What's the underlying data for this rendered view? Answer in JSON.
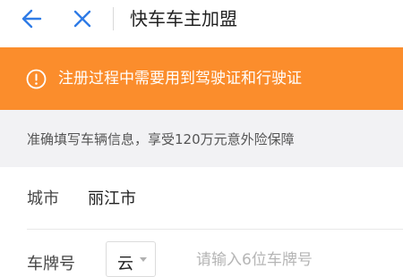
{
  "header": {
    "title": "快车车主加盟",
    "back_icon": "arrow-left-icon",
    "close_icon": "close-icon",
    "icon_color": "#2f7be6"
  },
  "notice": {
    "text": "注册过程中需要用到驾驶证和行驶证",
    "icon": "warning-circle-icon",
    "background": "#fb8d2c"
  },
  "info": {
    "text": "准确填写车辆信息，享受120万元意外险保障"
  },
  "form": {
    "city": {
      "label": "城市",
      "value": "丽江市"
    },
    "plate": {
      "label": "车牌号",
      "province_value": "云",
      "placeholder": "请输入6位车牌号"
    }
  }
}
